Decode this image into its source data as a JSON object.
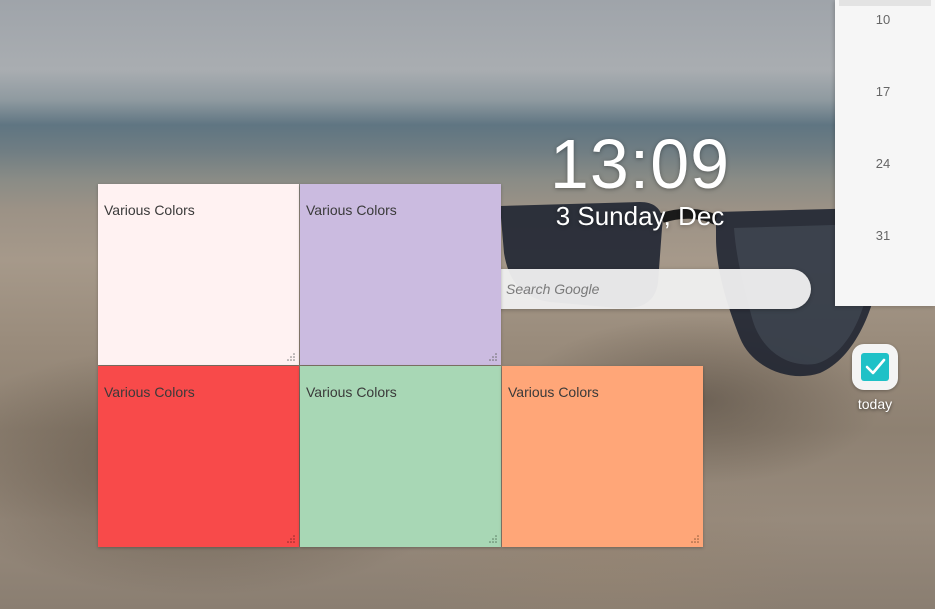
{
  "clock": {
    "time": "13:09",
    "date": "3 Sunday, Dec"
  },
  "search": {
    "placeholder": "Search Google",
    "icon": "google-g-icon"
  },
  "notes": [
    {
      "label": "Various Colors",
      "color": "#fff2f2"
    },
    {
      "label": "Various Colors",
      "color": "#cbbbe0"
    },
    {
      "label": "Various Colors",
      "color": "#f84a4a"
    },
    {
      "label": "Various Colors",
      "color": "#a8d7b5"
    },
    {
      "label": "Various Colors",
      "color": "#ffa678"
    }
  ],
  "calendar": {
    "days": [
      "10",
      "17",
      "24",
      "31"
    ]
  },
  "today_app": {
    "label": "today",
    "icon": "checkbox-check-icon",
    "accent": "#1fc1c7"
  }
}
